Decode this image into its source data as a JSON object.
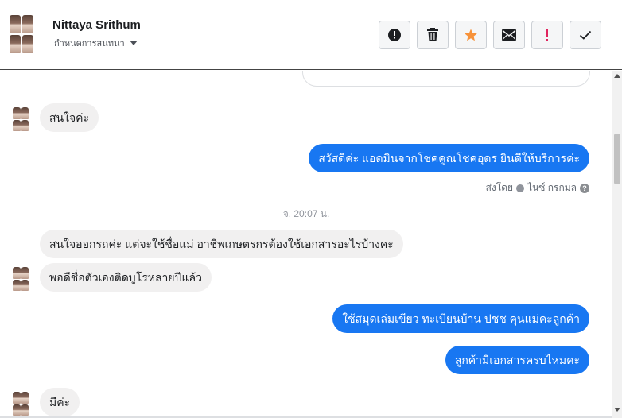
{
  "header": {
    "name": "Nittaya Srithum",
    "subtitle": "กำหนดการสนทนา"
  },
  "toolbar": {
    "buttons": [
      {
        "icon": "alert-circle-icon"
      },
      {
        "icon": "trash-icon"
      },
      {
        "icon": "star-icon",
        "color": "#f7923a"
      },
      {
        "icon": "envelope-icon"
      },
      {
        "icon": "exclamation-icon",
        "color": "#e0245e"
      },
      {
        "icon": "checkmark-icon"
      }
    ]
  },
  "messages": [
    {
      "direction": "in",
      "text": "สนใจค่ะ"
    },
    {
      "direction": "out",
      "text": "สวัสดีค่ะ แอดมินจากโชคคูณโชคอุดร ยินดีให้บริการค่ะ"
    },
    {
      "direction": "in",
      "text": "สนใจออกรถค่ะ แต่จะใช้ชื่อแม่ อาชีพเกษตรกรต้องใช้เอกสารอะไรบ้างคะ"
    },
    {
      "direction": "in",
      "text": "พอดีชื่อตัวเองติดบูโรหลายปีแล้ว"
    },
    {
      "direction": "out",
      "text": "ใช้สมุดเล่มเขียว ทะเบียนบ้าน ปชช คุนแม่คะลูกค้า"
    },
    {
      "direction": "out",
      "text": "ลูกค้ามีเอกสารครบไหมคะ"
    },
    {
      "direction": "in",
      "text": "มีค่ะ"
    }
  ],
  "sent_by": {
    "prefix": "ส่งโดย",
    "agent": "ไนซ์ กรกมล"
  },
  "timestamp": "จ. 20:07 น.",
  "colors": {
    "outgoing_bubble": "#1877f2",
    "incoming_bubble": "#f1f0f0"
  }
}
